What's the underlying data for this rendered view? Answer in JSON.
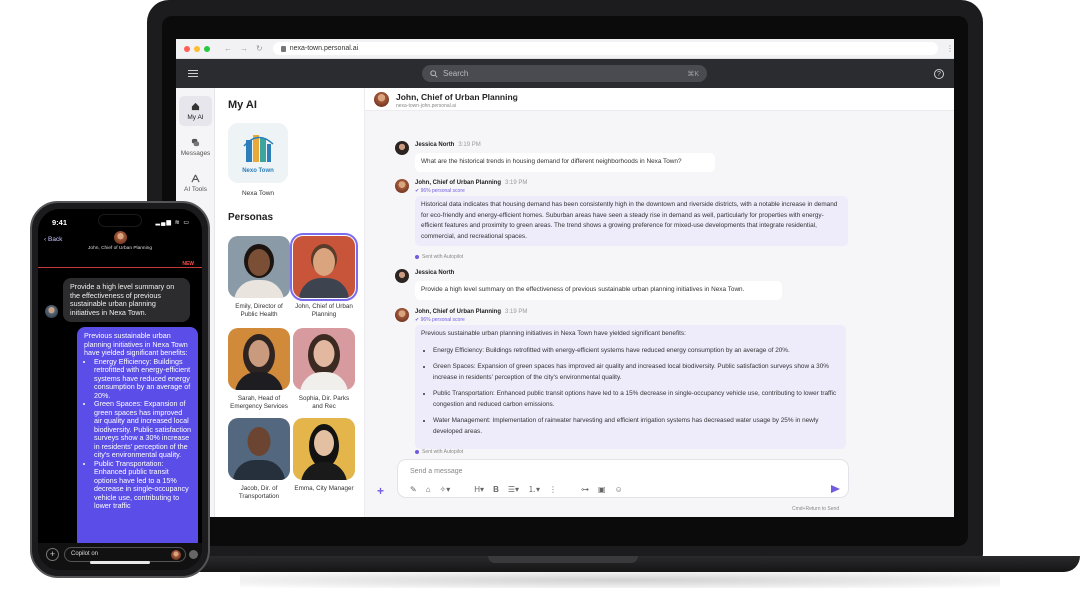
{
  "browser": {
    "url": "nexa-town.personal.ai",
    "traffic_colors": [
      "#ff5f57",
      "#febc2e",
      "#28c840"
    ]
  },
  "header": {
    "search_placeholder": "Search",
    "search_shortcut": "⌘K",
    "help": "?"
  },
  "rail": {
    "items": [
      {
        "label": "My AI",
        "icon": "home-icon",
        "active": true
      },
      {
        "label": "Messages",
        "icon": "chat-bubbles-icon",
        "active": false
      },
      {
        "label": "AI Tools",
        "icon": "tools-icon",
        "active": false
      }
    ]
  },
  "myai": {
    "title": "My AI",
    "nexo_logo_text": "Nexo Town",
    "nexo_label": "Nexa Town",
    "personas_title": "Personas",
    "personas": [
      {
        "label": "Emily, Director of Public Health",
        "bg": "#8a9aa6",
        "skin": "#7a4f35",
        "hair": "#1c1410"
      },
      {
        "label": "John, Chief of Urban Planning",
        "bg": "#c8553a",
        "skin": "#d9a47e",
        "hair": "#5a3c2a",
        "selected": true
      },
      {
        "label": "Sarah, Head of Emergency Services",
        "bg": "#d08a3a",
        "skin": "#c99a7e",
        "hair": "#2d2320"
      },
      {
        "label": "Sophia, Dir. Parks and Rec",
        "bg": "#d79a9e",
        "skin": "#e2b8a0",
        "hair": "#3a2a22"
      },
      {
        "label": "Jacob, Dir. of Transportation",
        "bg": "#53687e",
        "skin": "#6b4532",
        "hair": "#1a1a1a"
      },
      {
        "label": "Emma, City Manager",
        "bg": "#e3b54a",
        "skin": "#e4c0a2",
        "hair": "#121212"
      }
    ]
  },
  "chat": {
    "title": "John, Chief of Urban Planning",
    "subtitle": "nexa-town-john.personal.ai",
    "messages": [
      {
        "sender": "Jessica North",
        "time": "3:19 PM",
        "text": "What are the historical trends in housing demand for different neighborhoods in Nexa Town?"
      },
      {
        "sender": "John, Chief of Urban Planning",
        "time": "3:19 PM",
        "score": "96% personal score",
        "text": "Historical data indicates that housing demand has been consistently high in the downtown and riverside districts, with a notable increase in demand for eco-friendly and energy-efficient homes. Suburban areas have seen a steady rise in demand as well, particularly for properties with energy-efficient features and proximity to green areas. The trend shows a growing preference for mixed-use developments that integrate residential, commercial, and recreational spaces.",
        "autopilot": "Sent with Autopilot"
      },
      {
        "sender": "Jessica North",
        "time": "3:19 PM",
        "text": "Provide a high level summary on the effectiveness of previous sustainable urban planning initiatives in Nexa Town."
      },
      {
        "sender": "John, Chief of Urban Planning",
        "time": "3:19 PM",
        "score": "96% personal score",
        "intro": "Previous sustainable urban planning initiatives in Nexa Town have yielded significant benefits:",
        "bullets": [
          "Energy Efficiency: Buildings retrofitted with energy-efficient systems have reduced energy consumption by an average of 20%.",
          "Green Spaces: Expansion of green spaces has improved air quality and increased local biodiversity. Public satisfaction surveys show a 30% increase in residents' perception of the city's environmental quality.",
          "Public Transportation: Enhanced public transit options have led to a 15% decrease in single-occupancy vehicle use, contributing to lower traffic congestion and reduced carbon emissions.",
          "Water Management: Implementation of rainwater harvesting and efficient irrigation systems has decreased water usage by 25% in newly developed areas."
        ],
        "autopilot": "Sent with Autopilot"
      }
    ],
    "composer_placeholder": "Send a message",
    "send_hint": "Cmd+Return to Send",
    "accent": "#6f5ce0"
  },
  "phone": {
    "time": "9:41",
    "status": "▂▄▆ ≋ ▭",
    "back": "Back",
    "contact": "John, Chief of Urban Planning",
    "new_badge": "NEW",
    "user_message": "Provide a high level summary on the effectiveness of previous sustainable urban planning initiatives in Nexa Town.",
    "ai_intro": "Previous sustainable urban planning initiatives in Nexa Town have yielded significant benefits:",
    "ai_bullets": [
      "Energy Efficiency: Buildings retrofitted with energy-efficient systems have reduced energy consumption by an average of 20%.",
      "Green Spaces: Expansion of green spaces has improved air quality and increased local biodiversity. Public satisfaction surveys show a 30% increase in residents' perception of the city's environmental quality.",
      "Public Transportation: Enhanced public transit options have led to a 15% decrease in single-occupancy vehicle use, contributing to lower traffic"
    ],
    "input_placeholder": "Copilot on"
  }
}
